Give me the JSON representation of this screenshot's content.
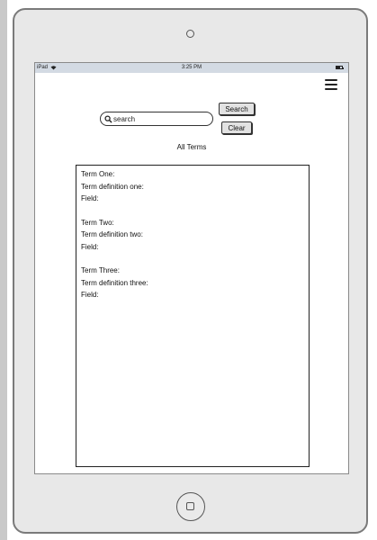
{
  "status_bar": {
    "carrier": "iPad",
    "time": "3:25 PM",
    "wifi_icon": "wifi-icon",
    "battery_icon": "battery-icon"
  },
  "header": {
    "menu_icon": "hamburger-menu-icon"
  },
  "search": {
    "placeholder": "search",
    "search_button_label": "Search",
    "clear_button_label": "Clear",
    "search_icon": "search-icon"
  },
  "terms_heading": "All Terms",
  "terms": [
    {
      "term": "Term One:",
      "definition": "Term definition one:",
      "field": "Field:"
    },
    {
      "term": "Term Two:",
      "definition": "Term definition two:",
      "field": "Field:"
    },
    {
      "term": "Term Three:",
      "definition": "Term definition three:",
      "field": "Field:"
    }
  ],
  "colors": {
    "device_frame": "#e8e8e8",
    "status_bar": "#d3dae3",
    "button_bg": "#e2e2e2"
  }
}
